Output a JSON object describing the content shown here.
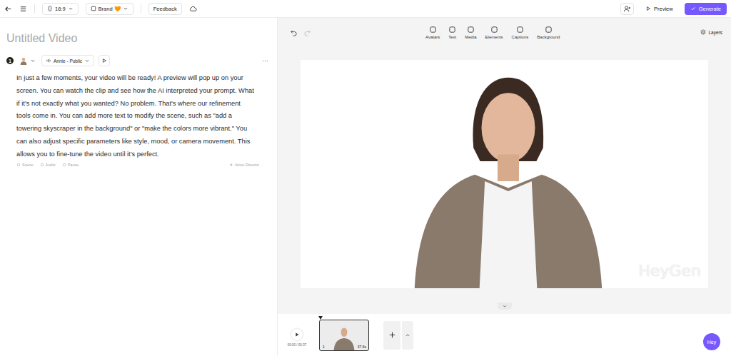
{
  "title": "Untitled Video",
  "topbar": {
    "aspect": "16:9",
    "brand": "Brand 🧡",
    "feedback": "Feedback",
    "preview": "Preview",
    "generate": "Generate"
  },
  "scene": {
    "number": "1",
    "voice": "Annie - Public",
    "more": "···",
    "script": "In just a few moments, your video will be ready! A preview will pop up on your screen. You can watch the clip and see how the AI interpreted your prompt. What if it's not exactly what you wanted? No problem. That's where our refinement tools come in. You can add more text to modify the scene, such as \"add a towering skyscraper in the background\" or \"make the colors more vibrant.\" You can also adjust specific parameters like style, mood, or camera movement. This allows you to fine-tune the video until it's perfect.",
    "tools": [
      "Scene",
      "Audio",
      "Pause"
    ],
    "voice_director": "Voice Director"
  },
  "toolbar": [
    "Avatars",
    "Text",
    "Media",
    "Elements",
    "Captions",
    "Background"
  ],
  "layers": "Layers",
  "canvas": {
    "watermark": "HeyGen"
  },
  "timeline": {
    "time": "00:00 / 00:37",
    "scenes": [
      {
        "number": "1",
        "duration": "37.6s",
        "selected": true
      }
    ]
  },
  "chat": "Hey"
}
